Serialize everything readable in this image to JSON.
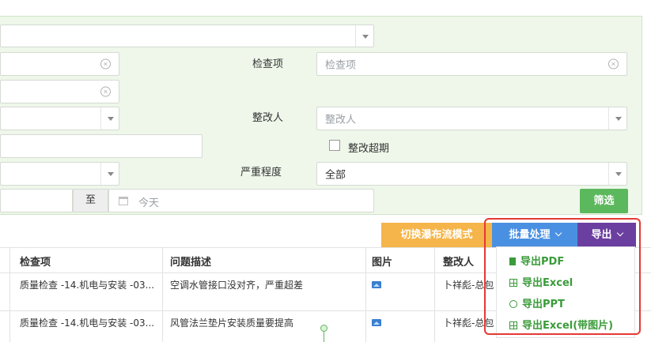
{
  "filters": {
    "inspection_item": {
      "label": "检查项",
      "placeholder": "检查项"
    },
    "rectifier": {
      "label": "整改人",
      "placeholder": "整改人"
    },
    "overdue": {
      "label": "整改超期"
    },
    "severity": {
      "label": "严重程度",
      "value": "全部"
    },
    "date_range": {
      "separator": "至",
      "end_placeholder": "今天"
    },
    "filter_button": "筛选"
  },
  "toolbar": {
    "waterfall_button": "切换瀑布流模式",
    "batch_button": "批量处理",
    "export_button": "导出"
  },
  "table": {
    "headers": [
      "检查项",
      "问题描述",
      "图片",
      "整改人"
    ],
    "rows": [
      {
        "item": "质量检查 -14.机电与安装 -03...",
        "desc": "空调水管接口没对齐，严重超差",
        "person": "卜祥彪-总包"
      },
      {
        "item": "质量检查 -14.机电与安装 -03...",
        "desc": "风管法兰垫片安装质量要提高",
        "person": "卜祥彪-总包"
      }
    ]
  },
  "export_menu": [
    {
      "icon": "pdf-file-icon",
      "label": "导出PDF"
    },
    {
      "icon": "table-grid-icon",
      "label": "导出Excel"
    },
    {
      "icon": "play-circle-icon",
      "label": "导出PPT"
    },
    {
      "icon": "table-grid-icon",
      "label": "导出Excel(带图片)"
    }
  ],
  "colors": {
    "panel_bg": "#eef7ea",
    "filter_green": "#5cb85c",
    "waterfall_orange": "#f5b54a",
    "batch_blue": "#4a90e2",
    "export_purple": "#6b3fa0",
    "highlight_red": "#e53935",
    "menu_text_green": "#3a9b3a"
  }
}
